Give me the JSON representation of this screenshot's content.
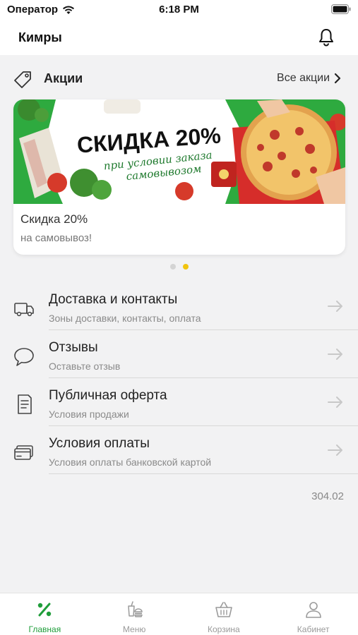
{
  "status_bar": {
    "carrier": "Оператор",
    "time": "6:18 PM"
  },
  "header": {
    "city": "Кимры",
    "bell_icon": "bell-icon"
  },
  "promos": {
    "title": "Акции",
    "all_link": "Все акции",
    "banner": {
      "headline": "СКИДКА 20%",
      "line1": "при условии заказа",
      "line2": "самовывозом"
    },
    "card_title": "Скидка 20%",
    "card_subtitle": "на самовывоз!",
    "pages": 2,
    "active_page": 2
  },
  "menu": {
    "items": [
      {
        "title": "Доставка и контакты",
        "subtitle": "Зоны доставки, контакты, оплата",
        "icon": "truck-icon"
      },
      {
        "title": "Отзывы",
        "subtitle": "Оставьте отзыв",
        "icon": "speech-bubble-icon"
      },
      {
        "title": "Публичная оферта",
        "subtitle": "Условия продажи",
        "icon": "document-icon"
      },
      {
        "title": "Условия оплаты",
        "subtitle": "Условия оплаты банковской картой",
        "icon": "credit-card-icon"
      }
    ]
  },
  "version": "304.02",
  "tabs": [
    {
      "label": "Главная",
      "icon": "percent-icon",
      "active": true
    },
    {
      "label": "Меню",
      "icon": "food-icon",
      "active": false
    },
    {
      "label": "Корзина",
      "icon": "basket-icon",
      "active": false
    },
    {
      "label": "Кабинет",
      "icon": "user-icon",
      "active": false
    }
  ],
  "colors": {
    "accent_green": "#1f9d3a",
    "banner_green": "#2eaa3f",
    "dot_active": "#f1c40f"
  }
}
